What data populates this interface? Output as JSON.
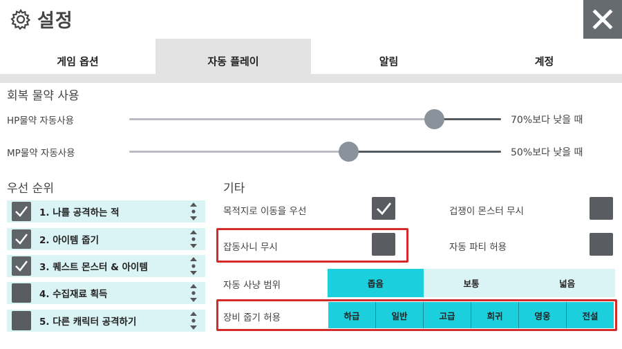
{
  "header": {
    "title": "설정",
    "gear_icon": "gear-icon",
    "close_icon": "close-icon"
  },
  "tabs": [
    {
      "label": "게임 옵션",
      "active": false
    },
    {
      "label": "자동 플레이",
      "active": true
    },
    {
      "label": "알림",
      "active": false
    },
    {
      "label": "계정",
      "active": false
    }
  ],
  "potion": {
    "section_title": "회복 물약 사용",
    "hp": {
      "label": "HP물약 자동사용",
      "value_text": "70%보다 낮을 때",
      "level": 0.82
    },
    "mp": {
      "label": "MP물약 자동사용",
      "value_text": "50%보다 낮을 때",
      "level": 0.59
    }
  },
  "priority": {
    "section_title": "우선 순위",
    "items": [
      {
        "label": "1. 나를 공격하는 적",
        "checked": true
      },
      {
        "label": "2. 아이템 줍기",
        "checked": true
      },
      {
        "label": "3. 퀘스트 몬스터 & 아이템",
        "checked": true
      },
      {
        "label": "4. 수집재료 획득",
        "checked": false
      },
      {
        "label": "5. 다른 캐릭터 공격하기",
        "checked": false
      }
    ]
  },
  "other": {
    "section_title": "기타",
    "move_priority": {
      "label": "목적지로 이동을 우선",
      "checked": true
    },
    "ignore_coward": {
      "label": "겁쟁이 몬스터 무시",
      "checked": false
    },
    "ignore_junk": {
      "label": "잡동사니 무시",
      "checked": false
    },
    "auto_party": {
      "label": "자동 파티 허용",
      "checked": false
    },
    "hunt_range": {
      "label": "자동 사냥 범위",
      "options": [
        "좁음",
        "보통",
        "넓음"
      ],
      "selected": "좁음"
    },
    "loot_grade": {
      "label": "장비 줍기 허용",
      "options": [
        "하급",
        "일반",
        "고급",
        "희귀",
        "영웅",
        "전설"
      ]
    }
  },
  "colors": {
    "accent": "#1ccfdc",
    "panel": "#daf3f5",
    "highlight_border": "#d42a2a"
  }
}
